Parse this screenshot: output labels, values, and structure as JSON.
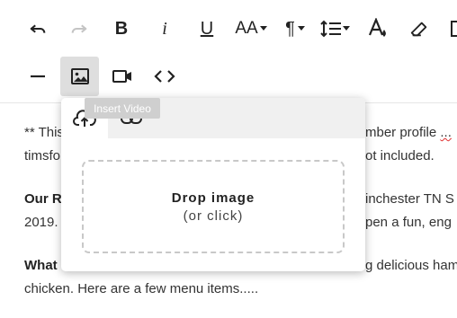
{
  "toolbar": {
    "bold_label": "B",
    "italic_label": "i",
    "underline_label": "U",
    "font_size_label": "AA",
    "paragraph_label": "¶",
    "insert_video_tooltip": "Insert Video"
  },
  "editor": {
    "line1_start": "** This",
    "line1_end": "mber profile",
    "line1_squiggle": "...",
    "line2_start": "timsfo",
    "line2_end": "ot included.",
    "line3_bold": "Our R",
    "line3_end": "inchester TN S",
    "line4_start": "2019.",
    "line4_end": "pen a fun, eng",
    "line5_bold": "What",
    "line5_end": "g delicious ham",
    "line6": "chicken. Here are a few menu items....."
  },
  "popup": {
    "drop_title": "Drop image",
    "drop_subtitle": "(or click)"
  },
  "colors": {
    "active_button_bg": "#dedede",
    "tooltip_bg": "#cfcfcf",
    "popup_tabs_bg": "#f0f0f0"
  }
}
